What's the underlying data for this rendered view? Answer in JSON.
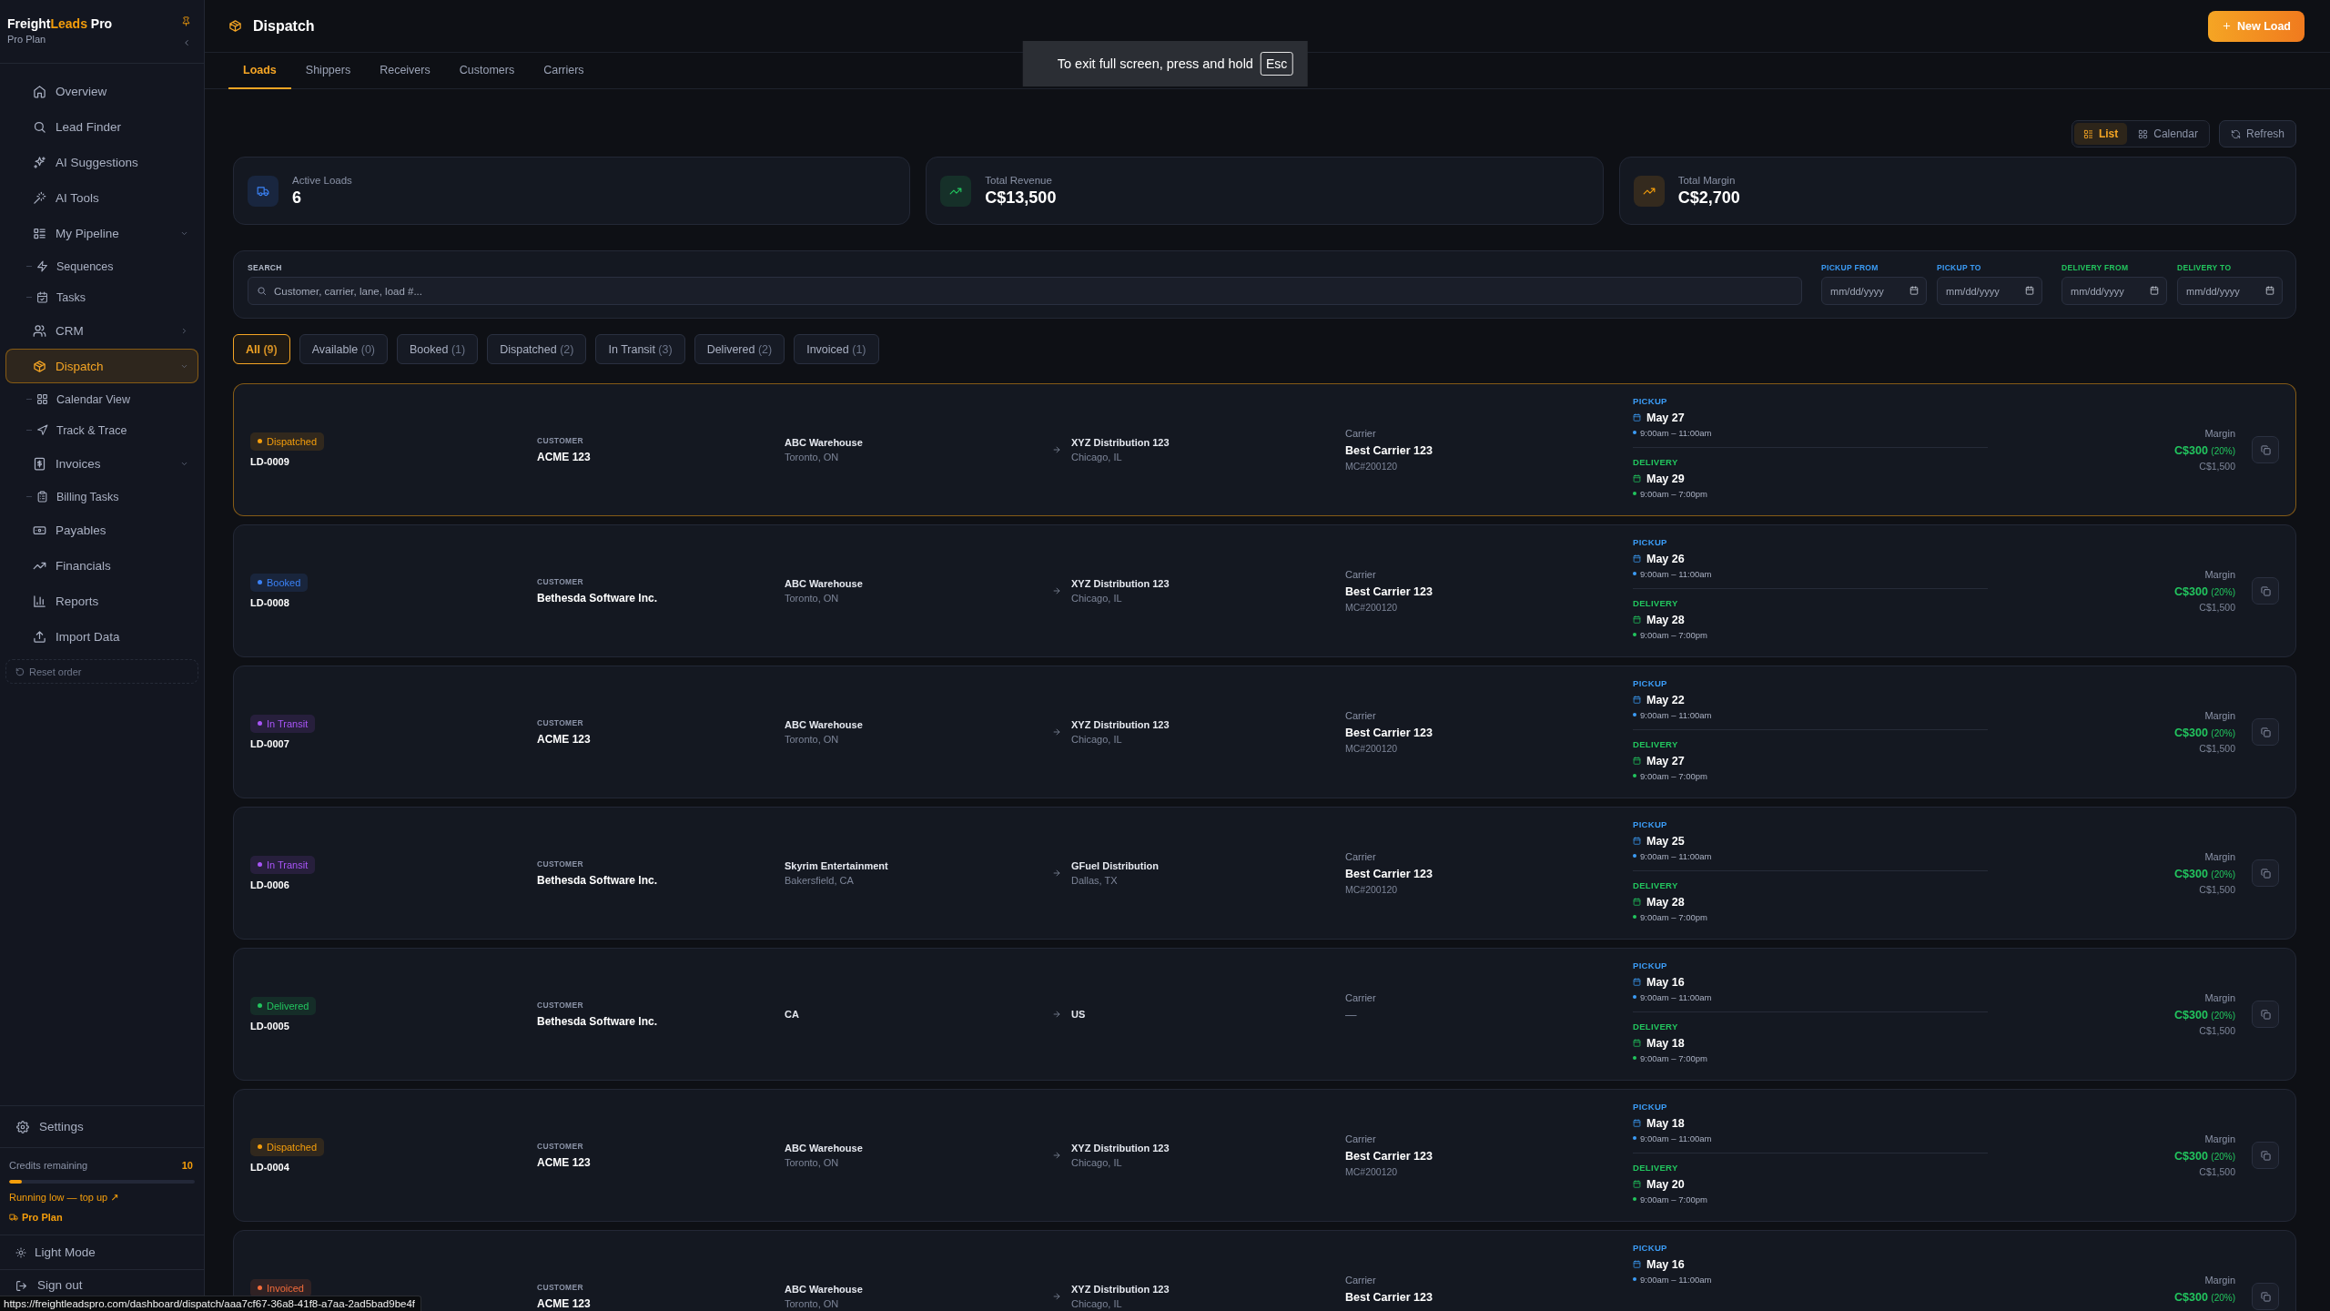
{
  "sidebar": {
    "brand": {
      "lead": "Freight",
      "accent": "Leads",
      "tail": "Pro"
    },
    "plan": "Pro Plan",
    "nav": [
      {
        "label": "Overview",
        "kind": "link",
        "selected": false
      },
      {
        "label": "Lead Finder",
        "kind": "link",
        "selected": false
      },
      {
        "label": "AI Suggestions",
        "kind": "link",
        "selected": false
      },
      {
        "label": "AI Tools",
        "kind": "link",
        "selected": false
      },
      {
        "label": "My Pipeline",
        "kind": "group",
        "selected": false,
        "expanded": true,
        "children": [
          {
            "label": "Sequences",
            "selected": false
          },
          {
            "label": "Tasks",
            "selected": false
          }
        ]
      },
      {
        "label": "CRM",
        "kind": "group",
        "selected": false,
        "expanded": false
      },
      {
        "label": "Dispatch",
        "kind": "group",
        "selected": true,
        "expanded": true,
        "children": [
          {
            "label": "Calendar View",
            "selected": false
          },
          {
            "label": "Track & Trace",
            "selected": false
          }
        ]
      },
      {
        "label": "Invoices",
        "kind": "group",
        "selected": false,
        "expanded": true,
        "children": [
          {
            "label": "Billing Tasks",
            "selected": false
          }
        ]
      },
      {
        "label": "Payables",
        "kind": "link",
        "selected": false
      },
      {
        "label": "Financials",
        "kind": "link",
        "selected": false
      },
      {
        "label": "Reports",
        "kind": "link",
        "selected": false
      },
      {
        "label": "Import Data",
        "kind": "link",
        "selected": false
      }
    ],
    "reset_order": "Reset order",
    "settings": "Settings",
    "credits": {
      "label": "Credits remaining",
      "value": "10",
      "level": 0.07,
      "warning": "Running low — top up ↗",
      "plan": "Pro Plan"
    },
    "theme_toggle": "Light Mode",
    "sign_out": "Sign out"
  },
  "header": {
    "title": "Dispatch",
    "new_button": "New Load"
  },
  "tabs": [
    {
      "label": "Loads",
      "selected": true
    },
    {
      "label": "Shippers",
      "selected": false
    },
    {
      "label": "Receivers",
      "selected": false
    },
    {
      "label": "Customers",
      "selected": false
    },
    {
      "label": "Carriers",
      "selected": false
    }
  ],
  "fullscreen_notice": {
    "text": "To exit full screen, press and hold",
    "key": "Esc"
  },
  "view_switch": [
    {
      "label": "List",
      "selected": true
    },
    {
      "label": "Calendar",
      "selected": false
    }
  ],
  "refresh_button": "Refresh",
  "stats": [
    {
      "label": "Active Loads",
      "value": "6",
      "color": "#3b82f6"
    },
    {
      "label": "Total Revenue",
      "value": "C$13,500",
      "color": "#22c55e"
    },
    {
      "label": "Total Margin",
      "value": "C$2,700",
      "color": "#f59e0b"
    }
  ],
  "filters": {
    "search": {
      "label": "SEARCH",
      "placeholder": "Customer, carrier, lane, load #..."
    },
    "dates": [
      {
        "kind": "pickup",
        "label": "PICKUP FROM",
        "placeholder": "mm/dd/yyyy"
      },
      {
        "kind": "pickup",
        "label": "PICKUP TO",
        "placeholder": "mm/dd/yyyy"
      },
      {
        "kind": "delivery",
        "label": "DELIVERY FROM",
        "placeholder": "mm/dd/yyyy"
      },
      {
        "kind": "delivery",
        "label": "DELIVERY TO",
        "placeholder": "mm/dd/yyyy"
      }
    ]
  },
  "status_chips": [
    {
      "label": "All",
      "count": "(9)",
      "selected": true
    },
    {
      "label": "Available",
      "count": "(0)",
      "selected": false
    },
    {
      "label": "Booked",
      "count": "(1)",
      "selected": false
    },
    {
      "label": "Dispatched",
      "count": "(2)",
      "selected": false
    },
    {
      "label": "In Transit",
      "count": "(3)",
      "selected": false
    },
    {
      "label": "Delivered",
      "count": "(2)",
      "selected": false
    },
    {
      "label": "Invoiced",
      "count": "(1)",
      "selected": false
    }
  ],
  "loads": [
    {
      "selected": true,
      "status": {
        "label": "Dispatched",
        "color": "#f59e0b"
      },
      "id": "LD-0009",
      "customer_label": "CUSTOMER",
      "customer": "ACME 123",
      "origin": {
        "name": "ABC Warehouse",
        "city": "Toronto, ON"
      },
      "destination": {
        "name": "XYZ Distribution 123",
        "city": "Chicago, IL"
      },
      "carrier": {
        "label": "Carrier",
        "name": "Best Carrier 123",
        "mc": "MC#200120",
        "assigned": true
      },
      "pickup": {
        "label": "PICKUP",
        "date": "May 27",
        "time": "9:00am – 11:00am"
      },
      "delivery": {
        "label": "DELIVERY",
        "date": "May 29",
        "time": "9:00am – 7:00pm"
      },
      "margin": {
        "label": "Margin",
        "value": "C$300",
        "percent": "(20%)",
        "total": "C$1,500"
      }
    },
    {
      "selected": false,
      "status": {
        "label": "Booked",
        "color": "#3b82f6"
      },
      "id": "LD-0008",
      "customer_label": "CUSTOMER",
      "customer": "Bethesda Software Inc.",
      "origin": {
        "name": "ABC Warehouse",
        "city": "Toronto, ON"
      },
      "destination": {
        "name": "XYZ Distribution 123",
        "city": "Chicago, IL"
      },
      "carrier": {
        "label": "Carrier",
        "name": "Best Carrier 123",
        "mc": "MC#200120",
        "assigned": true
      },
      "pickup": {
        "label": "PICKUP",
        "date": "May 26",
        "time": "9:00am – 11:00am"
      },
      "delivery": {
        "label": "DELIVERY",
        "date": "May 28",
        "time": "9:00am – 7:00pm"
      },
      "margin": {
        "label": "Margin",
        "value": "C$300",
        "percent": "(20%)",
        "total": "C$1,500"
      }
    },
    {
      "selected": false,
      "status": {
        "label": "In Transit",
        "color": "#a855f7"
      },
      "id": "LD-0007",
      "customer_label": "CUSTOMER",
      "customer": "ACME 123",
      "origin": {
        "name": "ABC Warehouse",
        "city": "Toronto, ON"
      },
      "destination": {
        "name": "XYZ Distribution 123",
        "city": "Chicago, IL"
      },
      "carrier": {
        "label": "Carrier",
        "name": "Best Carrier 123",
        "mc": "MC#200120",
        "assigned": true
      },
      "pickup": {
        "label": "PICKUP",
        "date": "May 22",
        "time": "9:00am – 11:00am"
      },
      "delivery": {
        "label": "DELIVERY",
        "date": "May 27",
        "time": "9:00am – 7:00pm"
      },
      "margin": {
        "label": "Margin",
        "value": "C$300",
        "percent": "(20%)",
        "total": "C$1,500"
      }
    },
    {
      "selected": false,
      "status": {
        "label": "In Transit",
        "color": "#a855f7"
      },
      "id": "LD-0006",
      "customer_label": "CUSTOMER",
      "customer": "Bethesda Software Inc.",
      "origin": {
        "name": "Skyrim Entertainment",
        "city": "Bakersfield, CA"
      },
      "destination": {
        "name": "GFuel Distribution",
        "city": "Dallas, TX"
      },
      "carrier": {
        "label": "Carrier",
        "name": "Best Carrier 123",
        "mc": "MC#200120",
        "assigned": true
      },
      "pickup": {
        "label": "PICKUP",
        "date": "May 25",
        "time": "9:00am – 11:00am"
      },
      "delivery": {
        "label": "DELIVERY",
        "date": "May 28",
        "time": "9:00am – 7:00pm"
      },
      "margin": {
        "label": "Margin",
        "value": "C$300",
        "percent": "(20%)",
        "total": "C$1,500"
      }
    },
    {
      "selected": false,
      "status": {
        "label": "Delivered",
        "color": "#22c55e"
      },
      "id": "LD-0005",
      "customer_label": "CUSTOMER",
      "customer": "Bethesda Software Inc.",
      "origin": {
        "name": "CA"
      },
      "destination": {
        "name": "US"
      },
      "carrier": {
        "label": "Carrier",
        "name": "—",
        "assigned": false
      },
      "pickup": {
        "label": "PICKUP",
        "date": "May 16",
        "time": "9:00am – 11:00am"
      },
      "delivery": {
        "label": "DELIVERY",
        "date": "May 18",
        "time": "9:00am – 7:00pm"
      },
      "margin": {
        "label": "Margin",
        "value": "C$300",
        "percent": "(20%)",
        "total": "C$1,500"
      }
    },
    {
      "selected": false,
      "status": {
        "label": "Dispatched",
        "color": "#f59e0b"
      },
      "id": "LD-0004",
      "customer_label": "CUSTOMER",
      "customer": "ACME 123",
      "origin": {
        "name": "ABC Warehouse",
        "city": "Toronto, ON"
      },
      "destination": {
        "name": "XYZ Distribution 123",
        "city": "Chicago, IL"
      },
      "carrier": {
        "label": "Carrier",
        "name": "Best Carrier 123",
        "mc": "MC#200120",
        "assigned": true
      },
      "pickup": {
        "label": "PICKUP",
        "date": "May 18",
        "time": "9:00am – 11:00am"
      },
      "delivery": {
        "label": "DELIVERY",
        "date": "May 20",
        "time": "9:00am – 7:00pm"
      },
      "margin": {
        "label": "Margin",
        "value": "C$300",
        "percent": "(20%)",
        "total": "C$1,500"
      }
    },
    {
      "selected": false,
      "status": {
        "label": "Invoiced",
        "color": "#f26b3a"
      },
      "customer_label": "CUSTOMER",
      "customer": "ACME 123",
      "origin": {
        "name": "ABC Warehouse",
        "city": "Toronto, ON"
      },
      "destination": {
        "name": "XYZ Distribution 123",
        "city": "Chicago, IL"
      },
      "carrier": {
        "label": "Carrier",
        "name": "Best Carrier 123",
        "assigned": true
      },
      "pickup": {
        "label": "PICKUP",
        "date": "May 16",
        "time": "9:00am – 11:00am"
      },
      "margin": {
        "label": "Margin",
        "value": "C$300",
        "percent": "(20%)"
      }
    }
  ],
  "browser_status": {
    "url": "https://freightleadspro.com/dashboard/dispatch/aaa7cf67-36a8-41f8-a7aa-2ad5bad9be4f"
  }
}
